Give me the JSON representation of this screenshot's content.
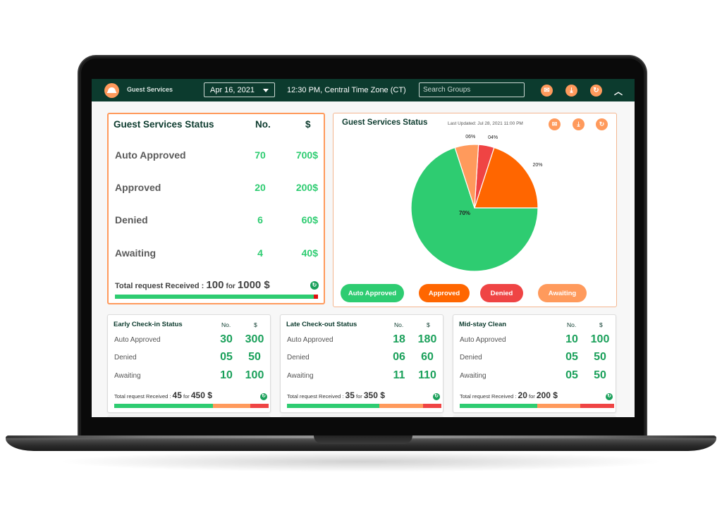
{
  "colors": {
    "topbar": "#0c3b2e",
    "accent": "#ff9a5c",
    "auto_approved": "#2ecc71",
    "approved": "#ff6600",
    "denied": "#ef4444",
    "awaiting": "#ff9a5c"
  },
  "topbar": {
    "app_title": "Guest Services",
    "date_value": "Apr 16, 2021",
    "time_text": "12:30 PM, Central Time Zone (CT)",
    "search_placeholder": "Search Groups",
    "icons": [
      "mail-icon",
      "download-icon",
      "refresh-icon"
    ],
    "collapse_icon": "chevron-up-icon"
  },
  "main_status": {
    "title": "Guest Services Status",
    "col_no": "No.",
    "col_amount": "$",
    "rows": [
      {
        "label": "Auto Approved",
        "no": "70",
        "amount": "700$"
      },
      {
        "label": "Approved",
        "no": "20",
        "amount": "200$"
      },
      {
        "label": "Denied",
        "no": "6",
        "amount": "60$"
      },
      {
        "label": "Awaiting",
        "no": "4",
        "amount": "40$"
      }
    ],
    "total_prefix": "Total request Received : ",
    "total_count": "100",
    "total_for": "for",
    "total_amount": "1000 $",
    "bar": [
      {
        "name": "auto-approved",
        "fraction": 0.98,
        "color": "#2ecc71"
      },
      {
        "name": "denied",
        "fraction": 0.02,
        "color": "#e01010"
      }
    ]
  },
  "pie_card": {
    "title": "Guest Services Status",
    "last_updated": "Last Updated: Jul 28, 2021 11:00 PM",
    "icons": [
      "mail-icon",
      "download-icon",
      "refresh-icon"
    ],
    "legend": [
      {
        "label": "Auto Approved",
        "color": "#2ecc71"
      },
      {
        "label": "Approved",
        "color": "#ff6600"
      },
      {
        "label": "Denied",
        "color": "#ef4444"
      },
      {
        "label": "Awaiting",
        "color": "#ff9a5c"
      }
    ]
  },
  "chart_data": {
    "type": "pie",
    "title": "Guest Services Status",
    "categories": [
      "Auto Approved",
      "Approved",
      "Denied",
      "Awaiting"
    ],
    "values": [
      70,
      20,
      4,
      6
    ],
    "labels": [
      "70%",
      "20%",
      "04%",
      "06%"
    ],
    "colors": [
      "#2ecc71",
      "#ff6600",
      "#ef4444",
      "#ff9a5c"
    ],
    "legend": "bottom"
  },
  "small_cards": [
    {
      "title": "Early Check-in Status",
      "col_no": "No.",
      "col_amount": "$",
      "rows": [
        {
          "label": "Auto Approved",
          "no": "30",
          "amount": "300"
        },
        {
          "label": "Denied",
          "no": "05",
          "amount": "50"
        },
        {
          "label": "Awaiting",
          "no": "10",
          "amount": "100"
        }
      ],
      "total_prefix": "Total request Received : ",
      "total_count": "45",
      "total_for": "for",
      "total_amount": "450 $",
      "bar": [
        {
          "name": "auto-approved",
          "fraction": 0.64,
          "color": "#2ecc71"
        },
        {
          "name": "awaiting",
          "fraction": 0.24,
          "color": "#ff9a5c"
        },
        {
          "name": "denied",
          "fraction": 0.12,
          "color": "#ef4444"
        }
      ]
    },
    {
      "title": "Late Check-out Status",
      "col_no": "No.",
      "col_amount": "$",
      "rows": [
        {
          "label": "Auto Approved",
          "no": "18",
          "amount": "180"
        },
        {
          "label": "Denied",
          "no": "06",
          "amount": "60"
        },
        {
          "label": "Awaiting",
          "no": "11",
          "amount": "110"
        }
      ],
      "total_prefix": "Total request Received : ",
      "total_count": "35",
      "total_for": "for",
      "total_amount": "350 $",
      "bar": [
        {
          "name": "auto-approved",
          "fraction": 0.6,
          "color": "#2ecc71"
        },
        {
          "name": "awaiting",
          "fraction": 0.28,
          "color": "#ff9a5c"
        },
        {
          "name": "denied",
          "fraction": 0.12,
          "color": "#ef4444"
        }
      ]
    },
    {
      "title": "Mid-stay Clean",
      "col_no": "No.",
      "col_amount": "$",
      "rows": [
        {
          "label": "Auto Approved",
          "no": "10",
          "amount": "100"
        },
        {
          "label": "Denied",
          "no": "05",
          "amount": "50"
        },
        {
          "label": "Awaiting",
          "no": "05",
          "amount": "50"
        }
      ],
      "total_prefix": "Total request Received : ",
      "total_count": "20",
      "total_for": "for",
      "total_amount": "200 $",
      "bar": [
        {
          "name": "auto-approved",
          "fraction": 0.5,
          "color": "#2ecc71"
        },
        {
          "name": "awaiting",
          "fraction": 0.28,
          "color": "#ff9a5c"
        },
        {
          "name": "denied",
          "fraction": 0.22,
          "color": "#ef4444"
        }
      ]
    }
  ]
}
